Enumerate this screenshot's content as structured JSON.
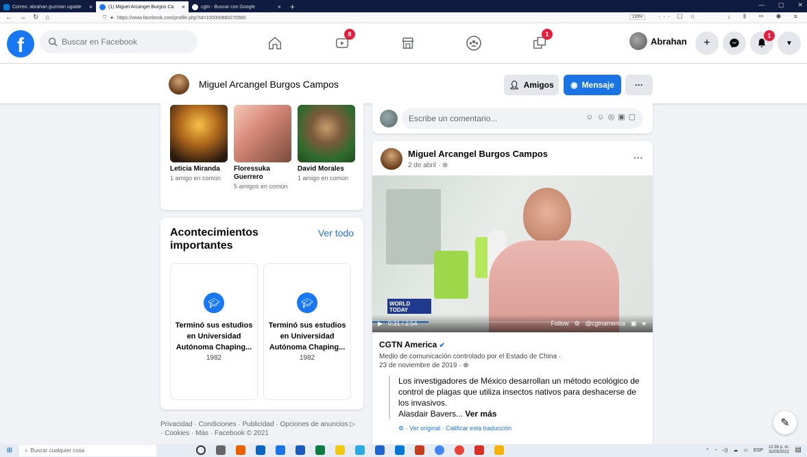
{
  "browser": {
    "tabs": [
      {
        "title": "Correo: abrahan guzman ugalde",
        "color": "#0078d4"
      },
      {
        "title": "(1) Miguel Arcangel Burgos Ca",
        "color": "#1877f2"
      },
      {
        "title": "cgtn - Buscar con Google",
        "color": "#4285f4"
      }
    ],
    "url": "https://www.facebook.com/profile.php?id=100000880270565",
    "zoom": "133%"
  },
  "fb": {
    "search_placeholder": "Buscar en Facebook",
    "video_badge": "8",
    "groups_badge": "1",
    "notif_badge": "1",
    "user_name": "Abrahan"
  },
  "profile_bar": {
    "name": "Miguel Arcangel Burgos Campos",
    "friends_btn": "Amigos",
    "message_btn": "Mensaje",
    "more_btn": "···"
  },
  "friends": [
    {
      "name": "Leticia Miranda",
      "mutual": "1 amigo en común"
    },
    {
      "name": "Floressuka Guerrero",
      "mutual": "5 amigos en común"
    },
    {
      "name": "David Morales",
      "mutual": "1 amigo en común"
    }
  ],
  "events": {
    "title": "Acontecimientos importantes",
    "see_all": "Ver todo",
    "items": [
      {
        "text": "Terminó sus estudios en Universidad Autónoma Chaping...",
        "year": "1982"
      },
      {
        "text": "Terminó sus estudios en Universidad Autónoma Chaping...",
        "year": "1982"
      }
    ]
  },
  "footer": "Privacidad · Condiciones · Publicidad · Opciones de anuncios ▷ · Cookies · Más · Facebook © 2021",
  "comment_placeholder": "Escribe un comentario...",
  "post": {
    "author": "Miguel Arcangel Burgos Campos",
    "date": "2 de abril · ",
    "video_time": "0:31 / 2:54",
    "video_channel": "@cgtnamerica",
    "video_follow": "Follow",
    "shared_page": "CGTN America",
    "shared_meta": "Medio de comunicación controlado por el Estado de China ·",
    "shared_date": "23 de noviembre de 2019 · ",
    "text": "Los investigadores de México desarrollan un método ecológico de control de plagas que utiliza insectos nativos para deshacerse de los invasivos.",
    "text_tail": "Alasdair Bavers...",
    "see_more": "Ver más",
    "translation": "· Ver original · Calificar esta traducción"
  },
  "taskbar": {
    "search": "Buscar cualquier cosa",
    "lang": "ESP",
    "time": "12:36 p. m.",
    "date": "31/05/2021"
  }
}
